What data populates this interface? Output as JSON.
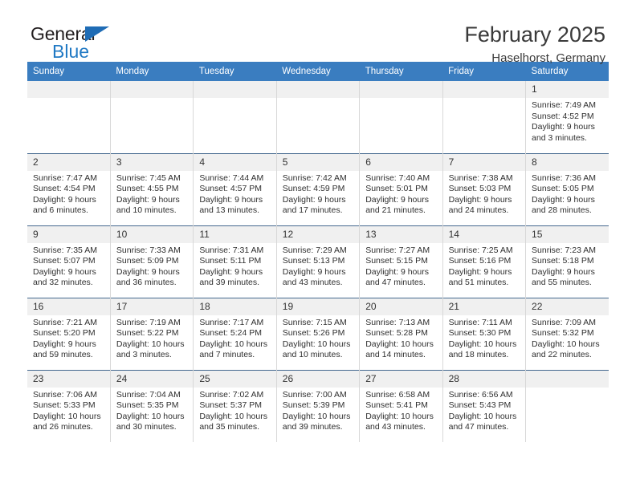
{
  "brand": {
    "name_top": "General",
    "name_bottom": "Blue",
    "triangle_color": "#1f6cb5",
    "text_color": "#231f20",
    "blue_text_color": "#2079c4"
  },
  "header": {
    "title": "February 2025",
    "subtitle": "Haselhorst, Germany"
  },
  "theme": {
    "header_row_bg": "#3a7dc0",
    "header_row_text": "#ffffff",
    "daynum_bg": "#f0f0f0",
    "row_divider": "#45698f",
    "cell_divider": "#d8d8d8"
  },
  "calendar": {
    "weekday_headers": [
      "Sunday",
      "Monday",
      "Tuesday",
      "Wednesday",
      "Thursday",
      "Friday",
      "Saturday"
    ],
    "weeks": [
      [
        {
          "day": "",
          "blank": true
        },
        {
          "day": "",
          "blank": true
        },
        {
          "day": "",
          "blank": true
        },
        {
          "day": "",
          "blank": true
        },
        {
          "day": "",
          "blank": true
        },
        {
          "day": "",
          "blank": true
        },
        {
          "day": "1",
          "sunrise": "Sunrise: 7:49 AM",
          "sunset": "Sunset: 4:52 PM",
          "daylight": "Daylight: 9 hours and 3 minutes."
        }
      ],
      [
        {
          "day": "2",
          "sunrise": "Sunrise: 7:47 AM",
          "sunset": "Sunset: 4:54 PM",
          "daylight": "Daylight: 9 hours and 6 minutes."
        },
        {
          "day": "3",
          "sunrise": "Sunrise: 7:45 AM",
          "sunset": "Sunset: 4:55 PM",
          "daylight": "Daylight: 9 hours and 10 minutes."
        },
        {
          "day": "4",
          "sunrise": "Sunrise: 7:44 AM",
          "sunset": "Sunset: 4:57 PM",
          "daylight": "Daylight: 9 hours and 13 minutes."
        },
        {
          "day": "5",
          "sunrise": "Sunrise: 7:42 AM",
          "sunset": "Sunset: 4:59 PM",
          "daylight": "Daylight: 9 hours and 17 minutes."
        },
        {
          "day": "6",
          "sunrise": "Sunrise: 7:40 AM",
          "sunset": "Sunset: 5:01 PM",
          "daylight": "Daylight: 9 hours and 21 minutes."
        },
        {
          "day": "7",
          "sunrise": "Sunrise: 7:38 AM",
          "sunset": "Sunset: 5:03 PM",
          "daylight": "Daylight: 9 hours and 24 minutes."
        },
        {
          "day": "8",
          "sunrise": "Sunrise: 7:36 AM",
          "sunset": "Sunset: 5:05 PM",
          "daylight": "Daylight: 9 hours and 28 minutes."
        }
      ],
      [
        {
          "day": "9",
          "sunrise": "Sunrise: 7:35 AM",
          "sunset": "Sunset: 5:07 PM",
          "daylight": "Daylight: 9 hours and 32 minutes."
        },
        {
          "day": "10",
          "sunrise": "Sunrise: 7:33 AM",
          "sunset": "Sunset: 5:09 PM",
          "daylight": "Daylight: 9 hours and 36 minutes."
        },
        {
          "day": "11",
          "sunrise": "Sunrise: 7:31 AM",
          "sunset": "Sunset: 5:11 PM",
          "daylight": "Daylight: 9 hours and 39 minutes."
        },
        {
          "day": "12",
          "sunrise": "Sunrise: 7:29 AM",
          "sunset": "Sunset: 5:13 PM",
          "daylight": "Daylight: 9 hours and 43 minutes."
        },
        {
          "day": "13",
          "sunrise": "Sunrise: 7:27 AM",
          "sunset": "Sunset: 5:15 PM",
          "daylight": "Daylight: 9 hours and 47 minutes."
        },
        {
          "day": "14",
          "sunrise": "Sunrise: 7:25 AM",
          "sunset": "Sunset: 5:16 PM",
          "daylight": "Daylight: 9 hours and 51 minutes."
        },
        {
          "day": "15",
          "sunrise": "Sunrise: 7:23 AM",
          "sunset": "Sunset: 5:18 PM",
          "daylight": "Daylight: 9 hours and 55 minutes."
        }
      ],
      [
        {
          "day": "16",
          "sunrise": "Sunrise: 7:21 AM",
          "sunset": "Sunset: 5:20 PM",
          "daylight": "Daylight: 9 hours and 59 minutes."
        },
        {
          "day": "17",
          "sunrise": "Sunrise: 7:19 AM",
          "sunset": "Sunset: 5:22 PM",
          "daylight": "Daylight: 10 hours and 3 minutes."
        },
        {
          "day": "18",
          "sunrise": "Sunrise: 7:17 AM",
          "sunset": "Sunset: 5:24 PM",
          "daylight": "Daylight: 10 hours and 7 minutes."
        },
        {
          "day": "19",
          "sunrise": "Sunrise: 7:15 AM",
          "sunset": "Sunset: 5:26 PM",
          "daylight": "Daylight: 10 hours and 10 minutes."
        },
        {
          "day": "20",
          "sunrise": "Sunrise: 7:13 AM",
          "sunset": "Sunset: 5:28 PM",
          "daylight": "Daylight: 10 hours and 14 minutes."
        },
        {
          "day": "21",
          "sunrise": "Sunrise: 7:11 AM",
          "sunset": "Sunset: 5:30 PM",
          "daylight": "Daylight: 10 hours and 18 minutes."
        },
        {
          "day": "22",
          "sunrise": "Sunrise: 7:09 AM",
          "sunset": "Sunset: 5:32 PM",
          "daylight": "Daylight: 10 hours and 22 minutes."
        }
      ],
      [
        {
          "day": "23",
          "sunrise": "Sunrise: 7:06 AM",
          "sunset": "Sunset: 5:33 PM",
          "daylight": "Daylight: 10 hours and 26 minutes."
        },
        {
          "day": "24",
          "sunrise": "Sunrise: 7:04 AM",
          "sunset": "Sunset: 5:35 PM",
          "daylight": "Daylight: 10 hours and 30 minutes."
        },
        {
          "day": "25",
          "sunrise": "Sunrise: 7:02 AM",
          "sunset": "Sunset: 5:37 PM",
          "daylight": "Daylight: 10 hours and 35 minutes."
        },
        {
          "day": "26",
          "sunrise": "Sunrise: 7:00 AM",
          "sunset": "Sunset: 5:39 PM",
          "daylight": "Daylight: 10 hours and 39 minutes."
        },
        {
          "day": "27",
          "sunrise": "Sunrise: 6:58 AM",
          "sunset": "Sunset: 5:41 PM",
          "daylight": "Daylight: 10 hours and 43 minutes."
        },
        {
          "day": "28",
          "sunrise": "Sunrise: 6:56 AM",
          "sunset": "Sunset: 5:43 PM",
          "daylight": "Daylight: 10 hours and 47 minutes."
        },
        {
          "day": "",
          "blank": true
        }
      ]
    ]
  }
}
